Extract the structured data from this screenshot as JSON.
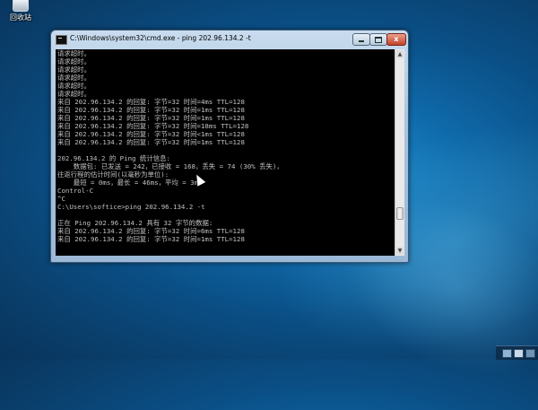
{
  "desktop": {
    "recycle_bin_label": "回收站"
  },
  "window": {
    "title": "C:\\Windows\\system32\\cmd.exe - ping  202.96.134.2 -t",
    "close_label": "x"
  },
  "console": {
    "lines": [
      "请求超时。",
      "请求超时。",
      "请求超时。",
      "请求超时。",
      "请求超时。",
      "请求超时。",
      "来自 202.96.134.2 的回复: 字节=32 时间=4ms TTL=128",
      "来自 202.96.134.2 的回复: 字节=32 时间=1ms TTL=128",
      "来自 202.96.134.2 的回复: 字节=32 时间=1ms TTL=128",
      "来自 202.96.134.2 的回复: 字节=32 时间=18ms TTL=128",
      "来自 202.96.134.2 的回复: 字节=32 时间<1ms TTL=128",
      "来自 202.96.134.2 的回复: 字节=32 时间=1ms TTL=128",
      "",
      "202.96.134.2 的 Ping 统计信息:",
      "    数据包: 已发送 = 242，已接收 = 168，丢失 = 74 (30% 丢失)，",
      "往返行程的估计时间(以毫秒为单位):",
      "    最短 = 0ms，最长 = 46ms，平均 = 3ms",
      "Control-C",
      "^C",
      "C:\\Users\\softice>ping 202.96.134.2 -t",
      "",
      "正在 Ping 202.96.134.2 具有 32 字节的数据:",
      "来自 202.96.134.2 的回复: 字节=32 时间=6ms TTL=128",
      "来自 202.96.134.2 的回复: 字节=32 时间=1ms TTL=128"
    ]
  }
}
